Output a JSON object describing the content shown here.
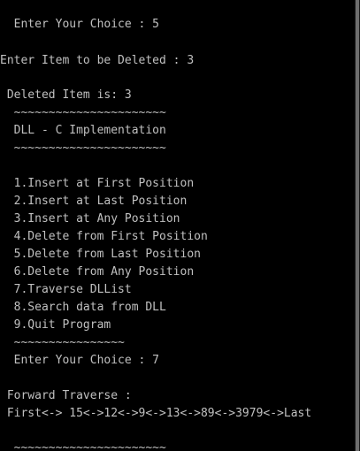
{
  "console": {
    "lines": [
      "  ~~~~~~~~~~~~~~~~",
      "  Enter Your Choice : 5",
      "",
      "Enter Item to be Deleted : 3",
      "",
      " Deleted Item is: 3",
      "  ~~~~~~~~~~~~~~~~~~~~~~",
      "  DLL - C Implementation",
      "  ~~~~~~~~~~~~~~~~~~~~~~",
      "",
      "  1.Insert at First Position",
      "  2.Insert at Last Position",
      "  3.Insert at Any Position",
      "  4.Delete from First Position",
      "  5.Delete from Last Position",
      "  6.Delete from Any Position",
      "  7.Traverse DLList",
      "  8.Search data from DLL",
      "  9.Quit Program",
      "  ~~~~~~~~~~~~~~~~",
      "  Enter Your Choice : 7",
      "",
      " Forward Traverse :",
      " First<-> 15<->12<->9<->13<->89<->3979<->Last",
      "",
      "  ~~~~~~~~~~~~~~~~~~~~~~"
    ]
  },
  "colors": {
    "background": "#000000",
    "text": "#c0c0c0",
    "scrollbar_track": "#1a1a1a",
    "scrollbar_thumb": "#6e6e6e"
  }
}
